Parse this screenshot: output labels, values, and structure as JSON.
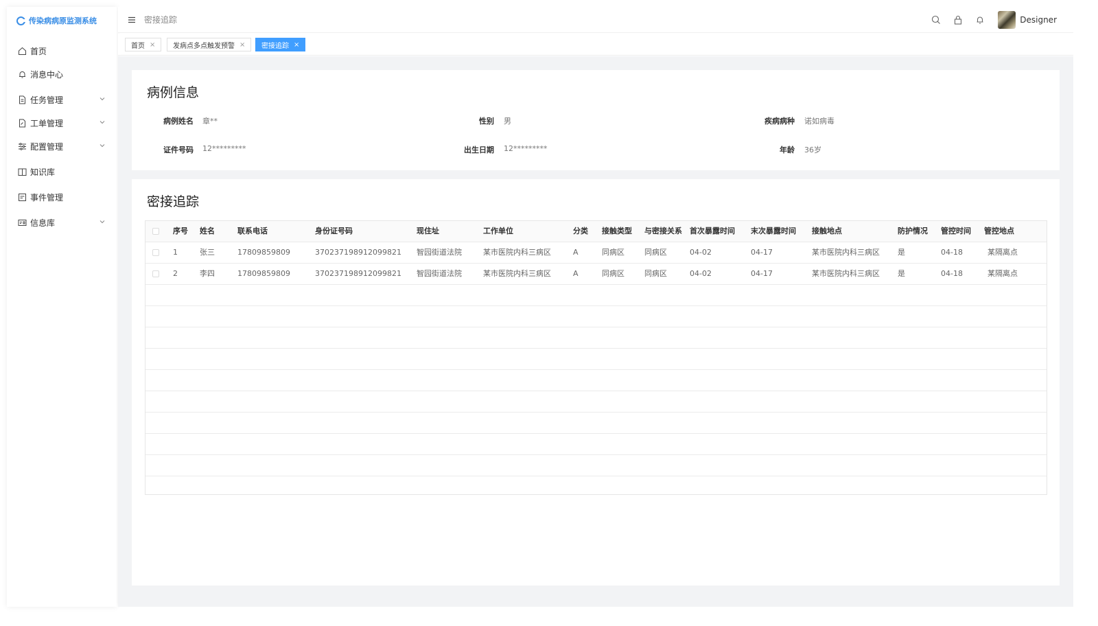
{
  "app": {
    "title": "传染病病原监测系统"
  },
  "sidebar": {
    "items": [
      {
        "label": "首页",
        "icon": "home-icon",
        "expandable": false
      },
      {
        "label": "消息中心",
        "icon": "bell-icon",
        "expandable": false
      },
      {
        "label": "任务管理",
        "icon": "document-icon",
        "expandable": true
      },
      {
        "label": "工单管理",
        "icon": "edit-document-icon",
        "expandable": true
      },
      {
        "label": "配置管理",
        "icon": "sliders-icon",
        "expandable": true
      },
      {
        "label": "知识库",
        "icon": "book-icon",
        "expandable": false
      },
      {
        "label": "事件管理",
        "icon": "calendar-icon",
        "expandable": false
      },
      {
        "label": "信息库",
        "icon": "id-card-icon",
        "expandable": true
      }
    ]
  },
  "header": {
    "title": "密接追踪",
    "username": "Designer"
  },
  "tabs": [
    {
      "label": "首页",
      "active": false
    },
    {
      "label": "发病点多点触发预警",
      "active": false
    },
    {
      "label": "密接追踪",
      "active": true
    }
  ],
  "case_info": {
    "title": "病例信息",
    "fields": {
      "name": {
        "label": "病例姓名",
        "value": "章**"
      },
      "gender": {
        "label": "性别",
        "value": "男"
      },
      "disease": {
        "label": "疾病病种",
        "value": "诺如病毒"
      },
      "id_number": {
        "label": "证件号码",
        "value": "12*********"
      },
      "birth_date": {
        "label": "出生日期",
        "value": "12*********"
      },
      "age": {
        "label": "年龄",
        "value": "36岁"
      }
    }
  },
  "tracking": {
    "title": "密接追踪",
    "columns": [
      "序号",
      "姓名",
      "联系电话",
      "身份证号码",
      "现住址",
      "工作单位",
      "分类",
      "接触类型",
      "与密接关系",
      "首次暴露时间",
      "末次暴露时间",
      "接触地点",
      "防护情况",
      "管控时间",
      "管控地点"
    ],
    "rows": [
      [
        "1",
        "张三",
        "17809859809",
        "370237198912099821",
        "智园街道法院",
        "某市医院内科三病区",
        "A",
        "同病区",
        "同病区",
        "04-02",
        "04-17",
        "某市医院内科三病区",
        "是",
        "04-18",
        "某隔离点"
      ],
      [
        "2",
        "李四",
        "17809859809",
        "370237198912099821",
        "智园街道法院",
        "某市医院内科三病区",
        "A",
        "同病区",
        "同病区",
        "04-02",
        "04-17",
        "某市医院内科三病区",
        "是",
        "04-18",
        "某隔离点"
      ]
    ]
  },
  "colors": {
    "accent": "#409eff",
    "logo": "#3a8ee6",
    "content_bg": "#f2f3f5"
  }
}
